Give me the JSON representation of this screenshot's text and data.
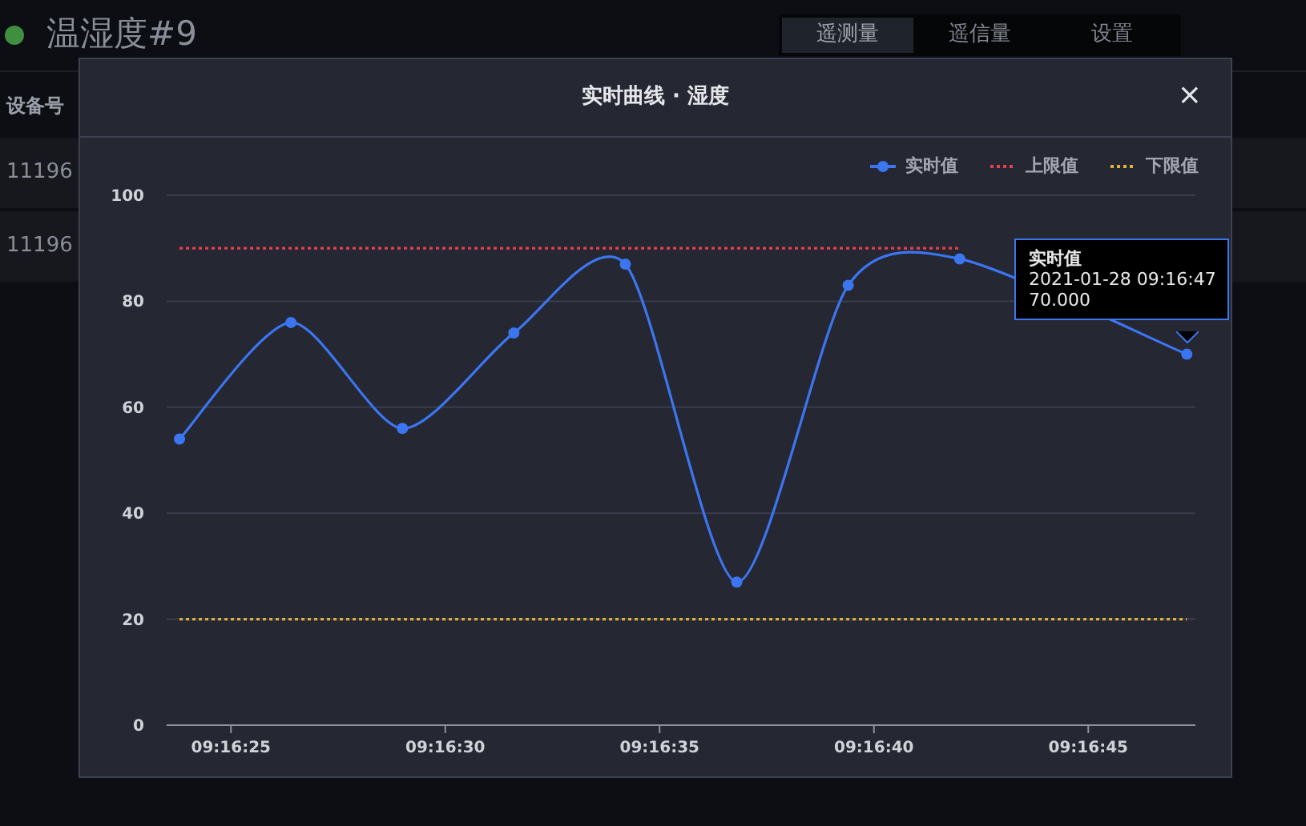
{
  "header": {
    "title": "温湿度#9",
    "online": true
  },
  "tabs": [
    {
      "label": "遥测量",
      "selected": true
    },
    {
      "label": "遥信量",
      "selected": false
    },
    {
      "label": "设置",
      "selected": false
    }
  ],
  "table": {
    "columns": [
      "设备号"
    ],
    "rows": [
      {
        "cells": [
          "11196"
        ]
      },
      {
        "cells": [
          "11196"
        ]
      }
    ]
  },
  "dialog": {
    "title": "实时曲线 · 湿度",
    "close": "×",
    "chart": {
      "chart_data": {
        "type": "line",
        "grid": true,
        "legend": true,
        "x": [
          33383.8,
          33386.4,
          33389.0,
          33391.6,
          33394.2,
          33396.8,
          33399.4,
          33402.0,
          33404.6,
          33407.3
        ],
        "xlim": [
          33383.5,
          33407.5
        ],
        "ylim": [
          0,
          100
        ],
        "xticks": [
          {
            "value": 33385,
            "label": "09:16:25"
          },
          {
            "value": 33390,
            "label": "09:16:30"
          },
          {
            "value": 33395,
            "label": "09:16:35"
          },
          {
            "value": 33400,
            "label": "09:16:40"
          },
          {
            "value": 33405,
            "label": "09:16:45"
          }
        ],
        "yticks": [
          0,
          20,
          40,
          60,
          80,
          100
        ],
        "series": [
          {
            "name": "实时值",
            "color": "#3b76f0",
            "marker": "circle",
            "line_style": "solid",
            "values": [
              54,
              76,
              56,
              74,
              87,
              27,
              83,
              88,
              null,
              70
            ]
          },
          {
            "name": "上限值",
            "color": "#e8404f",
            "line_style": "dotted",
            "values": [
              90,
              90,
              90,
              90,
              90,
              90,
              90,
              90,
              null,
              null
            ]
          },
          {
            "name": "下限值",
            "color": "#e0b33a",
            "line_style": "dotted",
            "values": [
              20,
              20,
              20,
              20,
              20,
              20,
              20,
              20,
              20,
              20
            ]
          }
        ]
      },
      "tooltip": {
        "title": "实时值",
        "time": "2021-01-28 09:16:47",
        "value": "70.000"
      }
    }
  }
}
